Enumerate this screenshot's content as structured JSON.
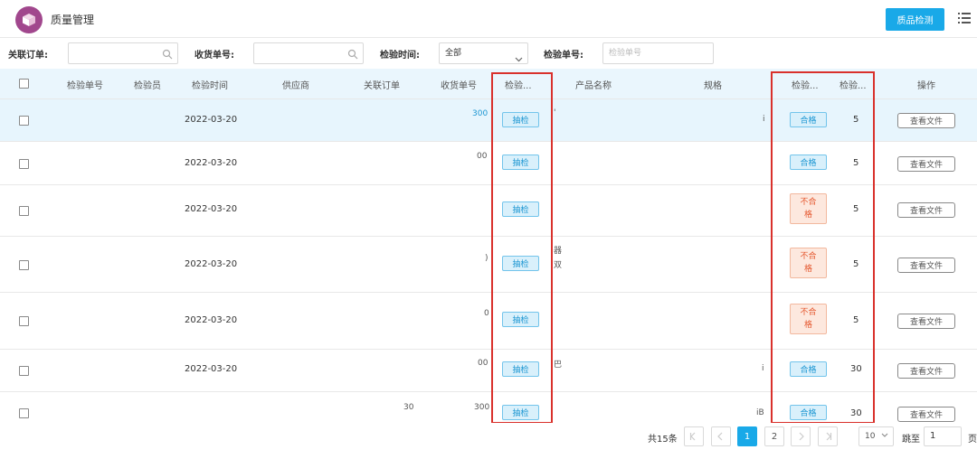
{
  "header": {
    "title": "质量管理",
    "primary_button": "质品检测",
    "accent": "#19a9e8",
    "logo_color": "#a1478d"
  },
  "filters": {
    "order_label": "关联订单:",
    "receipt_label": "收货单号:",
    "time_label": "检验时间:",
    "time_value": "全部",
    "inspect_no_label": "检验单号:",
    "inspect_no_placeholder": "检验单号"
  },
  "table": {
    "columns": [
      "检验单号",
      "检验员",
      "检验时间",
      "供应商",
      "关联订单",
      "收货单号",
      "检验...",
      "产品名称",
      "规格",
      "检验...",
      "检验...",
      "操作"
    ],
    "rows": [
      {
        "date": "2022-03-20",
        "frag_receipt": "300",
        "method": "抽检",
        "frag_name": "'",
        "frag_spec": "i",
        "result": "合格",
        "qty": "5",
        "action": "查看文件"
      },
      {
        "date": "2022-03-20",
        "frag_receipt": "00",
        "method": "抽检",
        "frag_name": "",
        "frag_spec": "",
        "result": "合格",
        "qty": "5",
        "action": "查看文件"
      },
      {
        "date": "2022-03-20",
        "frag_receipt": "",
        "method": "抽检",
        "frag_name": "",
        "frag_spec": "",
        "result": "不合格",
        "qty": "5",
        "action": "查看文件"
      },
      {
        "date": "2022-03-20",
        "frag_receipt": ")",
        "method": "抽检",
        "frag_name": "器 双",
        "frag_spec": "",
        "result": "不合格",
        "qty": "5",
        "action": "查看文件"
      },
      {
        "date": "2022-03-20",
        "frag_receipt": "0",
        "method": "抽检",
        "frag_name": "",
        "frag_spec": "",
        "result": "不合格",
        "qty": "5",
        "action": "查看文件"
      },
      {
        "date": "2022-03-20",
        "frag_receipt": "00",
        "method": "抽检",
        "frag_name": "巴",
        "frag_spec": "i",
        "result": "合格",
        "qty": "30",
        "action": "查看文件"
      },
      {
        "date": "",
        "frag_order": "30",
        "frag_receipt": "300",
        "method": "抽检",
        "frag_name": "",
        "frag_spec": "iB",
        "result": "合格",
        "qty": "30",
        "action": "查看文件"
      }
    ]
  },
  "pager": {
    "total": "共15条",
    "pages": [
      "1",
      "2"
    ],
    "page_size": "10",
    "jump_label": "跳至",
    "jump_value": "1",
    "jump_suffix": "页"
  }
}
